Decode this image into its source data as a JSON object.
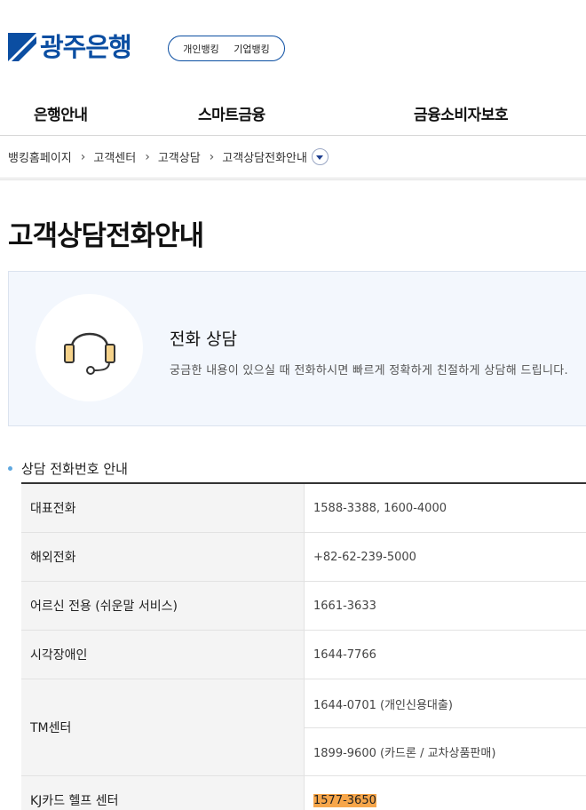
{
  "header": {
    "logo_text": "광주은행",
    "brand_color": "#0b4ea2",
    "banking_links": [
      "개인뱅킹",
      "기업뱅킹"
    ]
  },
  "gnb": {
    "items": [
      "은행안내",
      "스마트금융",
      "금융소비자보호"
    ]
  },
  "breadcrumb": {
    "items": [
      "뱅킹홈페이지",
      "고객센터",
      "고객상담",
      "고객상담전화안내"
    ]
  },
  "page": {
    "title": "고객상담전화안내"
  },
  "info_box": {
    "icon": "headset-icon",
    "title": "전화 상담",
    "description": "궁금한 내용이 있으실 때 전화하시면 빠르게 정확하게 친절하게 상담해 드립니다."
  },
  "section": {
    "title": "상담 전화번호 안내"
  },
  "table": {
    "rows": [
      {
        "label": "대표전화",
        "values": [
          "1588-3388, 1600-4000"
        ]
      },
      {
        "label": "해외전화",
        "values": [
          "+82-62-239-5000"
        ]
      },
      {
        "label": "어르신 전용 (쉬운말 서비스)",
        "values": [
          "1661-3633"
        ]
      },
      {
        "label": "시각장애인",
        "values": [
          "1644-7766"
        ]
      },
      {
        "label": "TM센터",
        "values": [
          "1644-0701 (개인신용대출)",
          "1899-9600 (카드론 / 교차상품판매)"
        ]
      },
      {
        "label": "KJ카드 헬프 센터",
        "values": [
          "1577-3650"
        ]
      }
    ],
    "highlight_color": "#f7a64a"
  }
}
